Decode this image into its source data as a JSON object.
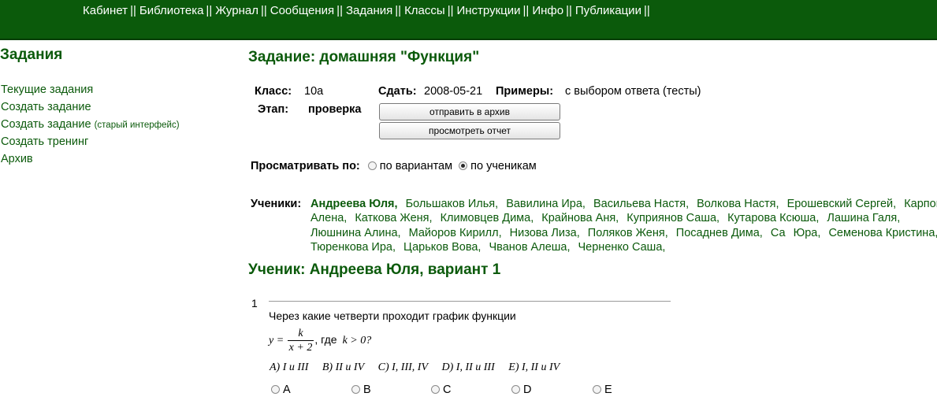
{
  "topnav": {
    "items": [
      {
        "label": "Кабинет"
      },
      {
        "label": "Библиотека"
      },
      {
        "label": "Журнал"
      },
      {
        "label": "Сообщения"
      },
      {
        "label": "Задания"
      },
      {
        "label": "Классы"
      },
      {
        "label": "Инструкции"
      },
      {
        "label": "Инфо"
      },
      {
        "label": "Публикации"
      }
    ],
    "separator": "||"
  },
  "sidebar": {
    "title": "Задания",
    "items": [
      {
        "label": "Текущие задания"
      },
      {
        "label": "Создать задание"
      },
      {
        "label": "Создать задание",
        "note": "(старый интерфейс)"
      },
      {
        "label": "Создать тренинг"
      },
      {
        "label": "Архив"
      }
    ]
  },
  "task": {
    "title": "Задание: домашняя \"Функция\"",
    "class_label": "Класс:",
    "class_value": "10а",
    "due_label": "Сдать:",
    "due_value": "2008-05-21",
    "examples_label": "Примеры:",
    "examples_value": "с выбором ответа (тесты)",
    "stage_label": "Этап:",
    "stage_value": "проверка",
    "archive_button": "отправить в архив",
    "report_button": "просмотреть отчет"
  },
  "view": {
    "label": "Просматривать по:",
    "options": [
      {
        "label": "по вариантам",
        "checked": false
      },
      {
        "label": "по ученикам",
        "checked": true
      }
    ]
  },
  "students": {
    "label": "Ученики:",
    "list": [
      "Андреева Юля",
      "Большаков Илья",
      "Вавилина Ира",
      "Васильева Настя",
      "Волкова Настя",
      "Ерошевский Сергей",
      "Карпова Алена",
      "Каткова Женя",
      "Климовцев Дима",
      "Крайнова Аня",
      "Куприянов Саша",
      "Кутарова Ксюша",
      "Лашина Галя",
      "Люшнина Алина",
      "Майоров Кирилл",
      "Низова Лиза",
      "Поляков Женя",
      "Посаднев Дима",
      "Са",
      "Юра",
      "Семенова Кристина",
      "Тюренкова Ира",
      "Царьков Вова",
      "Чванов Алеша",
      "Черненко Саша"
    ],
    "current_index": 0
  },
  "student_view": {
    "title": "Ученик: Андреева Юля, вариант 1"
  },
  "question": {
    "number": "1",
    "text": "Через какие четверти проходит график функции",
    "formula_lhs": "y =",
    "formula_num": "k",
    "formula_den": "x + 2",
    "formula_mid": ", где",
    "formula_cond": "k > 0?",
    "answers": [
      "A) I и III",
      "B) II и IV",
      "C) I, III, IV",
      "D) I, II и III",
      "E) I, II и IV"
    ],
    "choices": [
      "A",
      "B",
      "C",
      "D",
      "E"
    ]
  }
}
